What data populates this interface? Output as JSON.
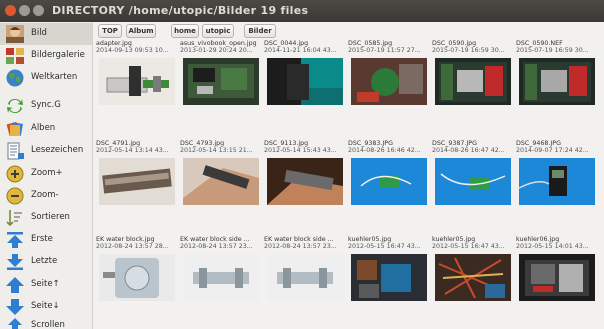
{
  "window": {
    "title": "DIRECTORY /home/utopic/Bilder 19 files"
  },
  "sidebar": {
    "items": [
      {
        "label": "Bild",
        "icon": "portrait-icon"
      },
      {
        "label": "Bildergalerie",
        "icon": "gallery-icon"
      },
      {
        "label": "Weltkarten",
        "icon": "globe-icon"
      },
      {
        "label": "Sync.G",
        "icon": "sync-icon"
      },
      {
        "label": "Alben",
        "icon": "albums-icon"
      },
      {
        "label": "Lesezeichen",
        "icon": "bookmark-icon"
      },
      {
        "label": "Zoom+",
        "icon": "zoom-in-icon"
      },
      {
        "label": "Zoom-",
        "icon": "zoom-out-icon"
      },
      {
        "label": "Sortieren",
        "icon": "sort-icon"
      },
      {
        "label": "Erste",
        "icon": "first-icon"
      },
      {
        "label": "Letzte",
        "icon": "last-icon"
      },
      {
        "label": "Seite↑",
        "icon": "page-up-icon"
      },
      {
        "label": "Seite↓",
        "icon": "page-down-icon"
      },
      {
        "label": "Scrollen",
        "icon": "scroll-icon"
      }
    ]
  },
  "path": {
    "crumbs": [
      "TOP",
      "Album",
      "home",
      "utopic",
      "Bilder"
    ]
  },
  "files": [
    {
      "name": "adapter.jpg",
      "date": "2014-09-13 09:53 10..."
    },
    {
      "name": "asus_vivobook_open.jpg",
      "date": "2013-01-29 20:24 20..."
    },
    {
      "name": "DSC_0044.jpg",
      "date": "2014-11-21 16:04 43..."
    },
    {
      "name": "DSC_0585.jpg",
      "date": "2015-07-19 11:57 27..."
    },
    {
      "name": "DSC_0590.jpg",
      "date": "2015-07-19 16:59 30..."
    },
    {
      "name": "DSC_0590.NEF",
      "date": "2015-07-19 16:59 30..."
    },
    {
      "name": "DSC_4791.jpg",
      "date": "2012-05-14 13:14 43..."
    },
    {
      "name": "DSC_4793.jpg",
      "date": "2012-05-14 13:15 21..."
    },
    {
      "name": "DSC_9113.jpg",
      "date": "2012-05-14 15:43 43..."
    },
    {
      "name": "DSC_9383.JPG",
      "date": "2014-08-26 16:46 42..."
    },
    {
      "name": "DSC_9387.JPG",
      "date": "2014-08-26 16:47 42..."
    },
    {
      "name": "DSC_9468.JPG",
      "date": "2014-09-07 17:24 42..."
    },
    {
      "name": "EK water block.jpg",
      "date": "2012-08-24 13:57 28..."
    },
    {
      "name": "EK water block side ...",
      "date": "2012-08-24 13:57 23..."
    },
    {
      "name": "EK water block side ...",
      "date": "2012-08-24 13:57 23..."
    },
    {
      "name": "kuehler05.jpg",
      "date": "2012-05-15 16:47 43..."
    },
    {
      "name": "kuehler05.jpg",
      "date": "2012-05-15 16:47 43..."
    },
    {
      "name": "kuehler06.jpg",
      "date": "2012-05-15 14:01 43..."
    }
  ],
  "colors": {
    "titlebar": "#3c3b37",
    "close": "#e0572f",
    "accent_blue": "#2f7fd0"
  }
}
